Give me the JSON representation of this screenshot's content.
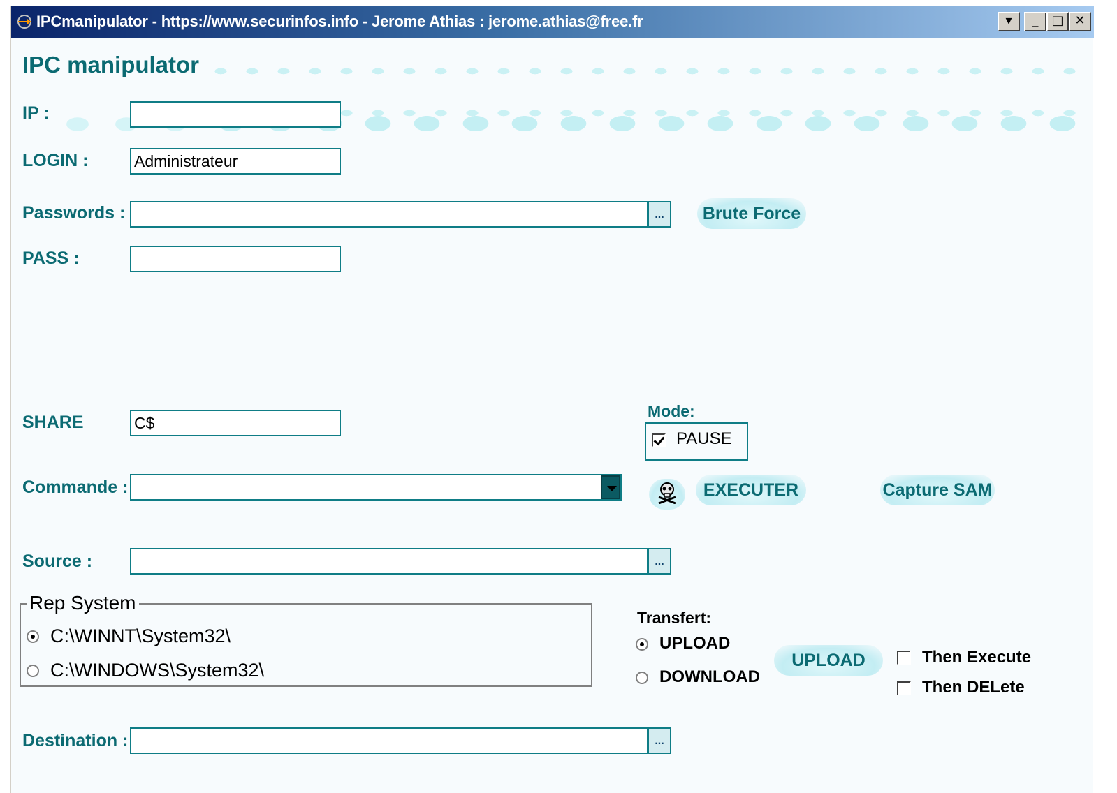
{
  "window": {
    "title": "IPCmanipulator - https://www.securinfos.info - Jerome Athias : jerome.athias@free.fr",
    "controls": {
      "help": "▾",
      "minimize": "_",
      "maximize": "□",
      "close": "✕"
    }
  },
  "app_title": "IPC manipulator",
  "form": {
    "ip": {
      "label": "IP :",
      "value": ""
    },
    "login": {
      "label": "LOGIN :",
      "value": "Administrateur"
    },
    "passwords": {
      "label": "Passwords :",
      "value": "",
      "browse": "..."
    },
    "pass": {
      "label": "PASS :",
      "value": ""
    },
    "share": {
      "label": "SHARE",
      "value": "C$"
    },
    "commande": {
      "label": "Commande :",
      "value": ""
    },
    "source": {
      "label": "Source :",
      "value": "",
      "browse": "..."
    },
    "destination": {
      "label": "Destination :",
      "value": "",
      "browse": "..."
    }
  },
  "buttons": {
    "brute_force": "Brute Force",
    "executer": "EXECUTER",
    "capture_sam": "Capture SAM",
    "upload": "UPLOAD"
  },
  "mode": {
    "label": "Mode:",
    "pause_label": "PAUSE",
    "pause_checked": true
  },
  "rep_system": {
    "title": "Rep System",
    "options": [
      {
        "label": "C:\\WINNT\\System32\\",
        "selected": true
      },
      {
        "label": "C:\\WINDOWS\\System32\\",
        "selected": false
      }
    ]
  },
  "transfert": {
    "label": "Transfert:",
    "options": [
      {
        "label": "UPLOAD",
        "selected": true
      },
      {
        "label": "DOWNLOAD",
        "selected": false
      }
    ]
  },
  "post_actions": {
    "then_execute": {
      "label": "Then Execute",
      "checked": false
    },
    "then_delete": {
      "label": "Then DELete",
      "checked": false
    }
  },
  "colors": {
    "accent": "#0b6a72",
    "field_border": "#0f7d86",
    "titlebar": "#0a246a"
  }
}
